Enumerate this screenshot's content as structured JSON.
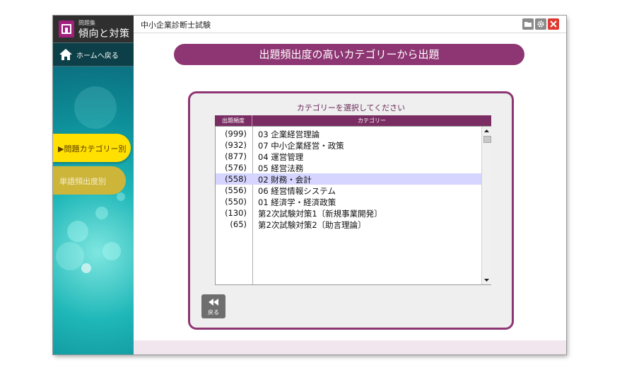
{
  "app": {
    "subtitle_small": "問題集",
    "title": "傾向と対策",
    "brand_color": "#a1207c"
  },
  "window": {
    "title": "中小企業診断士試験"
  },
  "titlebar_buttons": {
    "folder_icon": "folder-icon",
    "settings_icon": "gear-icon",
    "close_icon": "close-icon"
  },
  "sidebar": {
    "home_label": "ホームへ戻る",
    "tabs": [
      {
        "label": "▶問題カテゴリー別",
        "active": true
      },
      {
        "label": "単語頻出度別",
        "active": false
      }
    ]
  },
  "main": {
    "title": "出題頻出度の高いカテゴリーから出題",
    "accent_color": "#8e3673"
  },
  "panel": {
    "caption": "カテゴリーを選択してください",
    "columns": {
      "frequency": "出題頻度",
      "category": "カテゴリー"
    },
    "rows": [
      {
        "freq": "(999)",
        "cat": "03 企業経営理論"
      },
      {
        "freq": "(932)",
        "cat": "07 中小企業経営・政策"
      },
      {
        "freq": "(877)",
        "cat": "04 運営管理"
      },
      {
        "freq": "(576)",
        "cat": "05 経営法務"
      },
      {
        "freq": "(558)",
        "cat": "02 財務・会計"
      },
      {
        "freq": "(556)",
        "cat": "06 経営情報システム"
      },
      {
        "freq": "(550)",
        "cat": "01 経済学・経済政策"
      },
      {
        "freq": "(130)",
        "cat": "第2次試験対策1〔新規事業開発〕"
      },
      {
        "freq": "(65)",
        "cat": "第2次試験対策2〔助言理論〕"
      }
    ],
    "selected_index": 4,
    "back_label": "戻る"
  }
}
